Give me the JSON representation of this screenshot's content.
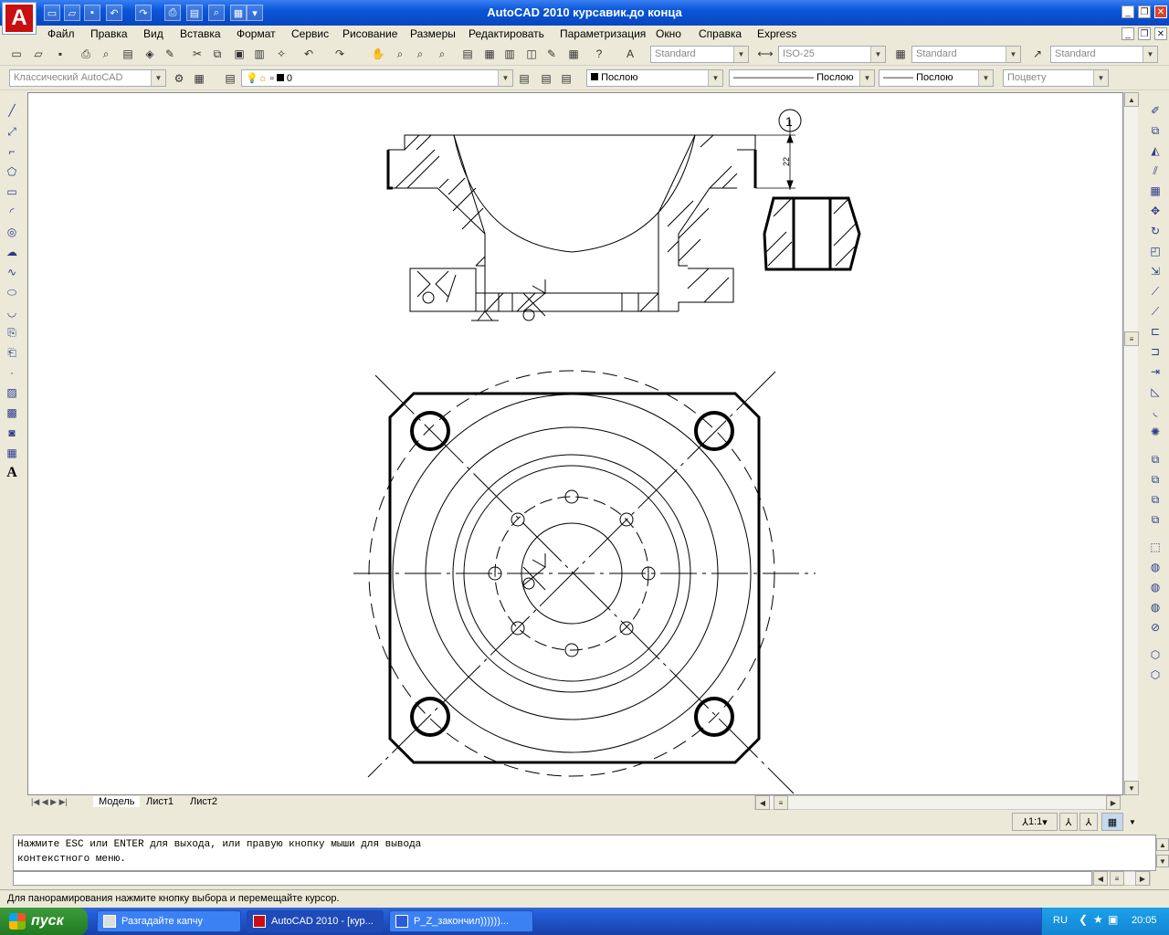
{
  "window": {
    "title": "AutoCAD 2010     курсавик.до конца",
    "app_logo_letter": "A"
  },
  "menu": [
    "Файл",
    "Правка",
    "Вид",
    "Вставка",
    "Формат",
    "Сервис",
    "Рисование",
    "Размеры",
    "Редактировать",
    "Параметризация",
    "Окно",
    "Справка",
    "Express"
  ],
  "styles_toolbar": {
    "text_style": "Standard",
    "dim_style": "ISO-25",
    "table_style": "Standard",
    "mleader_style": "Standard"
  },
  "workspace": "Классический AutoCAD",
  "layers": {
    "current_layer": "0",
    "color": "Послою",
    "linetype": "Послою",
    "lineweight": "Послою",
    "plotstyle": "Поцвету"
  },
  "drawing": {
    "balloon_number": "1",
    "dimension_value": "22"
  },
  "tabs": [
    "Модель",
    "Лист1",
    "Лист2"
  ],
  "annotation_scale": "1:1",
  "command_line": {
    "line1": "Нажмите ESC или ENTER для выхода, или правую кнопку мыши для вывода",
    "line2": "контекстного меню."
  },
  "status_bar": "Для панорамирования нажмите кнопку выбора и перемещайте курсор.",
  "taskbar": {
    "start_label": "пуск",
    "tasks": [
      "Разгадайте капчу",
      "AutoCAD 2010 - [кур...",
      "P_Z_закончил))))))..."
    ],
    "language": "RU",
    "clock": "20:05"
  }
}
